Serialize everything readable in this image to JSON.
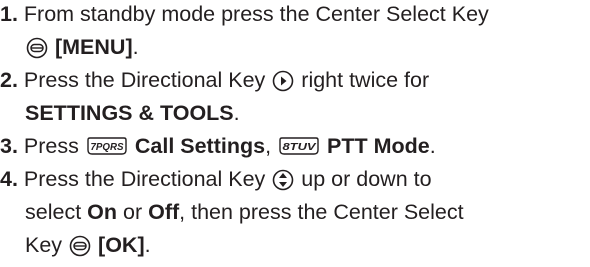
{
  "steps": [
    {
      "number": "1.",
      "lines": [
        {
          "text_a": "From standby mode press the Center Select Key"
        },
        {
          "icon": "center-select-key-icon",
          "bold": "[MENU]",
          "after": "."
        }
      ]
    },
    {
      "number": "2.",
      "lines": [
        {
          "before": "Press the Directional Key",
          "icon": "directional-right-key-icon",
          "after": "right twice for"
        },
        {
          "bold": "SETTINGS & TOOLS",
          "after": "."
        }
      ]
    },
    {
      "number": "3.",
      "before": "Press",
      "key1": {
        "icon": "7-pqrs-key-icon",
        "glyph": "7PQRS",
        "label": "Call Settings"
      },
      "sep": ",",
      "key2": {
        "icon": "8-tuv-key-icon",
        "glyph": "8TUV",
        "label": "PTT Mode"
      },
      "after": "."
    },
    {
      "number": "4.",
      "lines": [
        {
          "before": "Press the Directional Key",
          "icon": "directional-up-down-key-icon",
          "after": "up or down to"
        },
        {
          "before": "select",
          "bold1": "On",
          "mid": "or",
          "bold2": "Off",
          "after": ", then press the Center Select"
        },
        {
          "before": "Key",
          "icon": "center-select-key-icon",
          "bold": "[OK]",
          "after": "."
        }
      ]
    }
  ]
}
